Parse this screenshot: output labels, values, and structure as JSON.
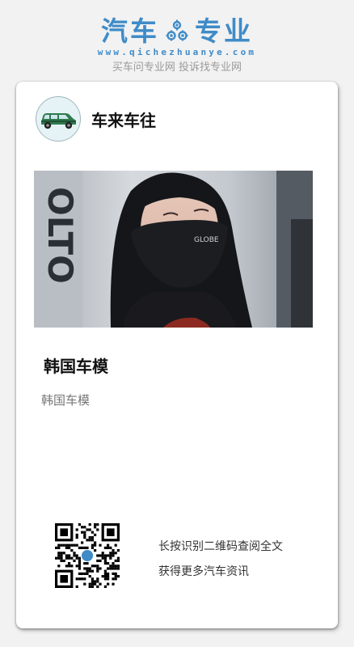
{
  "brand": {
    "word_left": "汽车",
    "word_right": "专业",
    "icon": "gear-icon",
    "url": "www.qichezhuanye.com",
    "slogan": "买车问专业网 投诉找专业网",
    "color": "#3f8bc8"
  },
  "author": {
    "name": "车来车往",
    "avatar_icon": "car-icon"
  },
  "article": {
    "image_icon": "photo",
    "title": "韩国车模",
    "summary": "韩国车模"
  },
  "footer": {
    "qr_icon": "qr-code-icon",
    "line1": "长按识别二维码查阅全文",
    "line2": "获得更多汽车资讯"
  }
}
